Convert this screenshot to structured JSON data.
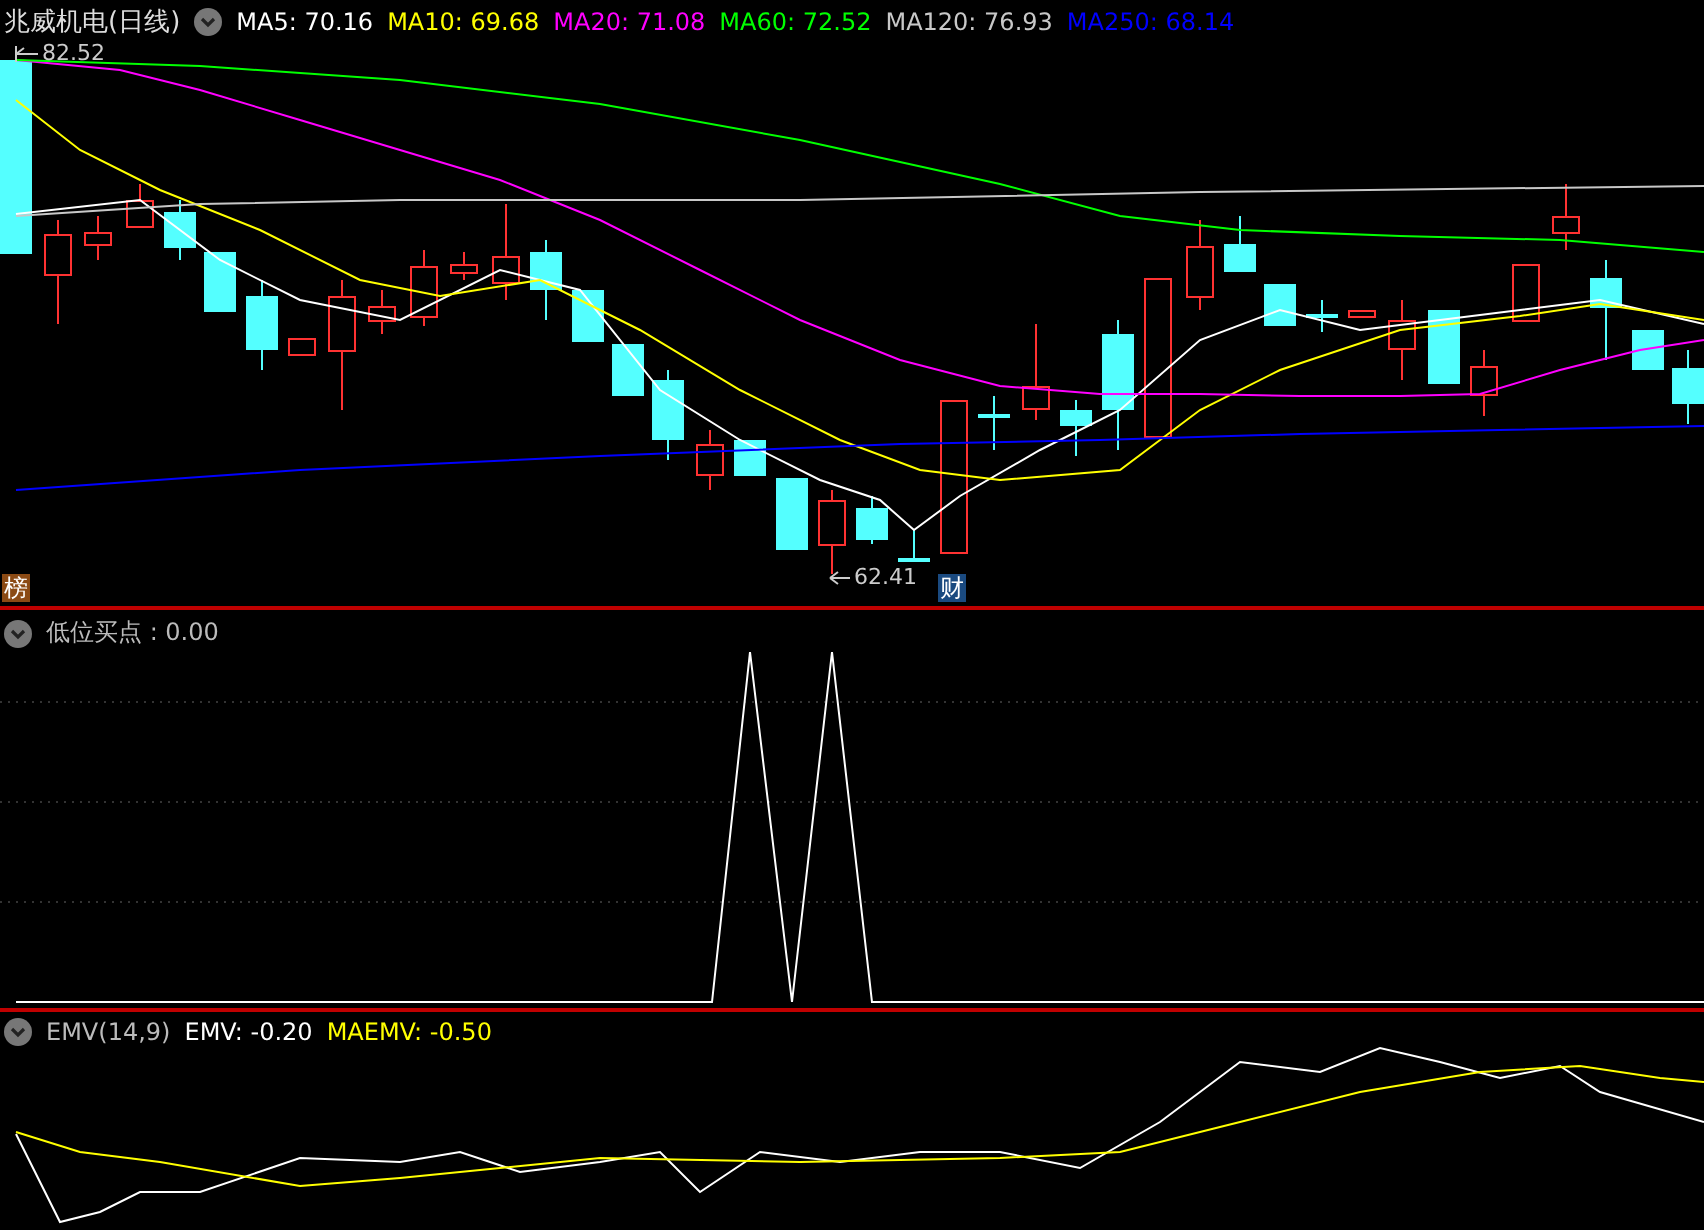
{
  "header": {
    "title": "兆威机电(日线)",
    "ma": [
      {
        "label": "MA5: 70.16",
        "color": "#ffffff"
      },
      {
        "label": "MA10: 69.68",
        "color": "#ffff00"
      },
      {
        "label": "MA20: 71.08",
        "color": "#ff00ff"
      },
      {
        "label": "MA60: 72.52",
        "color": "#00ff00"
      },
      {
        "label": "MA120: 76.93",
        "color": "#c8c8c8"
      },
      {
        "label": "MA250: 68.14",
        "color": "#0000ff"
      }
    ]
  },
  "main_chart": {
    "high_label": "82.52",
    "low_label": "62.41",
    "badges": [
      {
        "text": "榜",
        "color": "#8b4a14"
      },
      {
        "text": "财",
        "color": "#1a4a80"
      }
    ]
  },
  "indicator_1": {
    "title": "低位买点 : 0.00"
  },
  "indicator_2": {
    "title": "EMV(14,9)",
    "items": [
      {
        "label": "EMV: -0.20",
        "color": "#ffffff"
      },
      {
        "label": "MAEMV: -0.50",
        "color": "#ffff00"
      }
    ]
  }
}
